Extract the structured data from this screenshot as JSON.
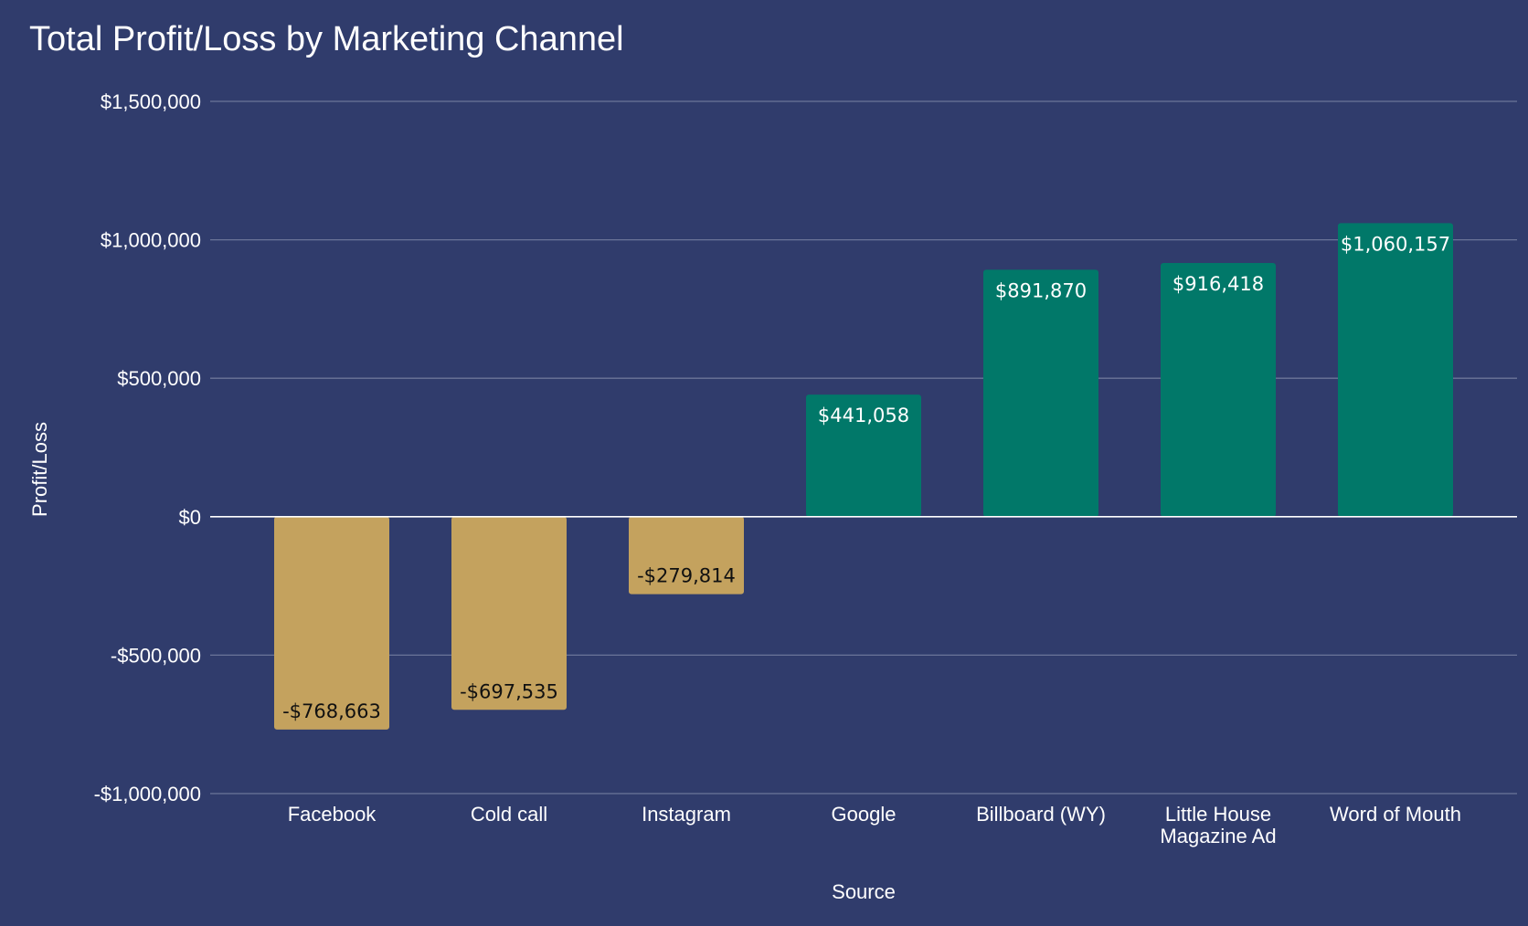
{
  "chart_data": {
    "type": "bar",
    "title": "Total Profit/Loss by Marketing Channel",
    "xlabel": "Source",
    "ylabel": "Profit/Loss",
    "categories": [
      "Facebook",
      "Cold call",
      "Instagram",
      "Google",
      "Billboard (WY)",
      "Little House Magazine Ad",
      "Word of Mouth"
    ],
    "category_labels": [
      [
        "Facebook"
      ],
      [
        "Cold call"
      ],
      [
        "Instagram"
      ],
      [
        "Google"
      ],
      [
        "Billboard (WY)"
      ],
      [
        "Little House",
        "Magazine Ad"
      ],
      [
        "Word of Mouth"
      ]
    ],
    "values": [
      -768663,
      -697535,
      -279814,
      441058,
      891870,
      916418,
      1060157
    ],
    "data_labels": [
      "-$768,663",
      "-$697,535",
      "-$279,814",
      "$441,058",
      "$891,870",
      "$916,418",
      "$1,060,157"
    ],
    "ylim": [
      -1000000,
      1500000
    ],
    "yticks": [
      -1000000,
      -500000,
      0,
      500000,
      1000000,
      1500000
    ],
    "ytick_labels": [
      "-$1,000,000",
      "-$500,000",
      "$0",
      "$500,000",
      "$1,000,000",
      "$1,500,000"
    ],
    "grid": true,
    "legend": "none",
    "colors": {
      "background": "#303c6c",
      "positive": "#017869",
      "negative": "#c4a25e",
      "gridline": "#6b7599",
      "zero_line": "#ffffff",
      "text": "#ffffff",
      "positive_label": "#ffffff",
      "negative_label": "#111111"
    }
  }
}
